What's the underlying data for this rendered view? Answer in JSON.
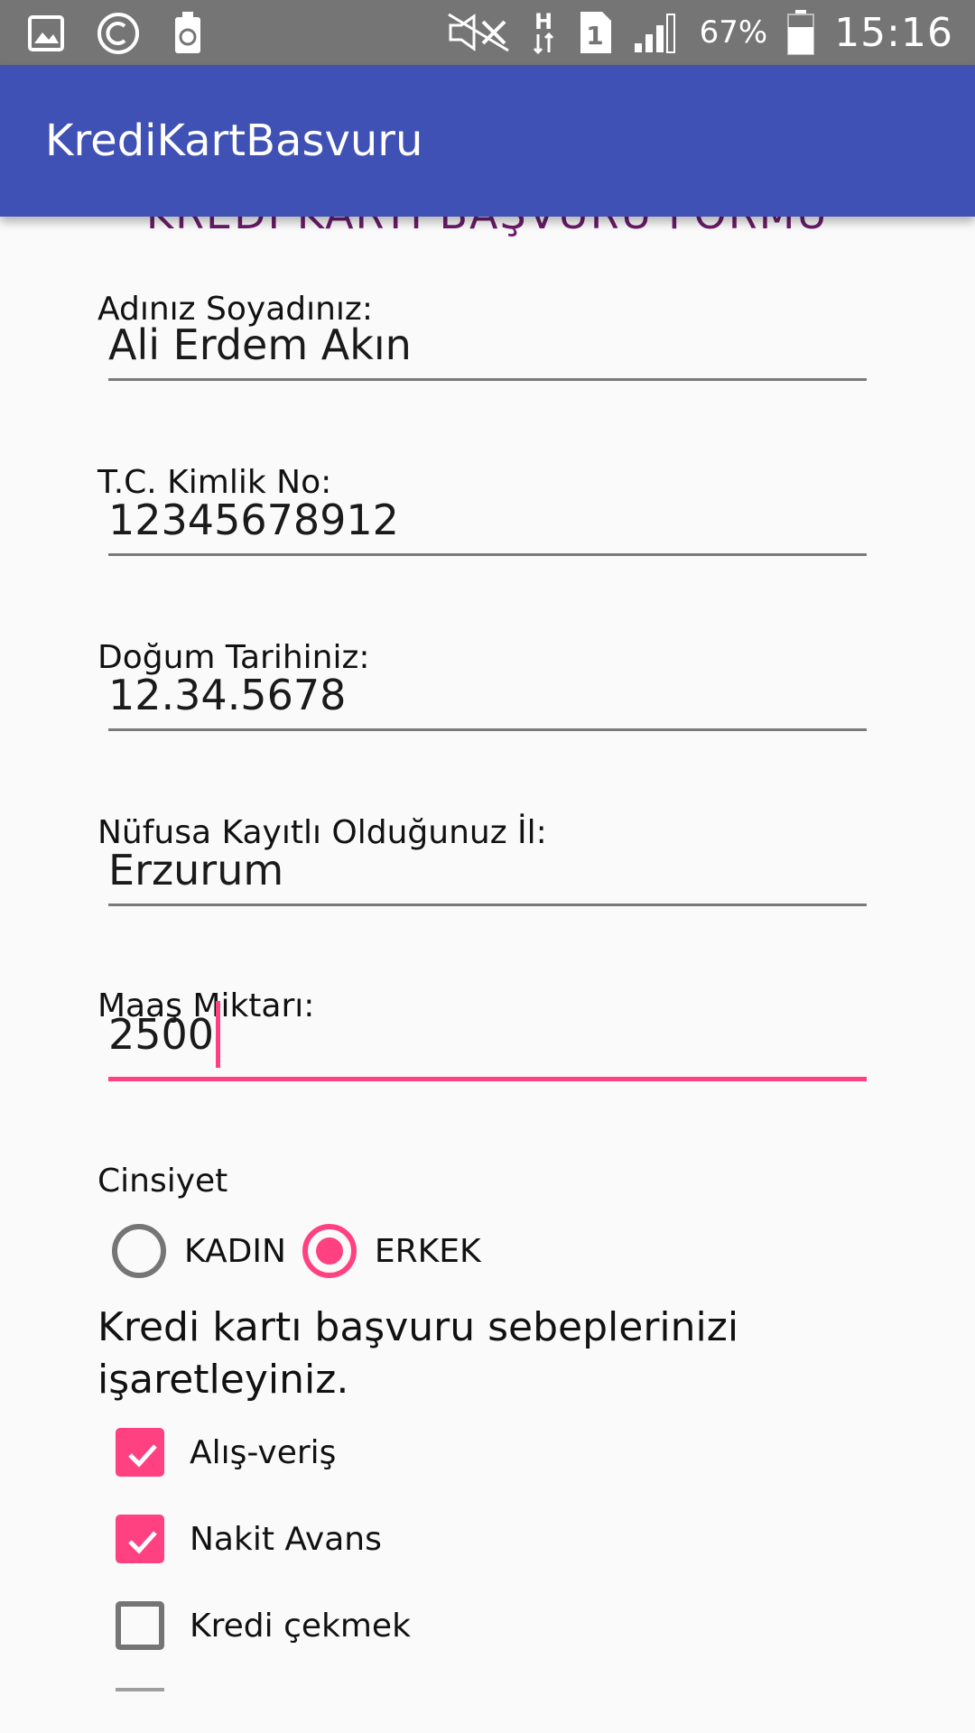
{
  "status_bar": {
    "battery": "67%",
    "time": "15:16",
    "sim": "1",
    "network": "H",
    "icons": [
      "image-icon",
      "copyright-icon",
      "recycle-icon",
      "mute-icon",
      "network-h-icon",
      "sim-icon",
      "signal-icon",
      "battery-icon"
    ]
  },
  "app_bar": {
    "title": "KrediKartBasvuru"
  },
  "form": {
    "heading": "KREDİ KARTI BAŞVURU FORMU",
    "name": {
      "label": "Adınız Soyadınız:",
      "value": "Ali Erdem Akın"
    },
    "tc": {
      "label": "T.C. Kimlik No:",
      "value": "12345678912"
    },
    "birth": {
      "label": "Doğum Tarihiniz:",
      "value": "12.34.5678"
    },
    "city": {
      "label": "Nüfusa Kayıtlı Olduğunuz İl:",
      "value": "Erzurum"
    },
    "salary": {
      "label": "Maaş Miktarı:",
      "value": "2500"
    },
    "gender": {
      "label": "Cinsiyet",
      "options": [
        {
          "label": "KADIN",
          "checked": false
        },
        {
          "label": "ERKEK",
          "checked": true
        }
      ]
    },
    "reasons": {
      "prompt": "Kredi kartı başvuru sebeplerinizi işaretleyiniz.",
      "options": [
        {
          "label": "Alış-veriş",
          "checked": true
        },
        {
          "label": "Nakit Avans",
          "checked": true
        },
        {
          "label": "Kredi çekmek",
          "checked": false
        }
      ]
    }
  },
  "colors": {
    "status_bar": "#757575",
    "app_bar": "#3f51b5",
    "accent": "#ff4081",
    "heading": "#6a1b6a",
    "background": "#fafafa"
  }
}
